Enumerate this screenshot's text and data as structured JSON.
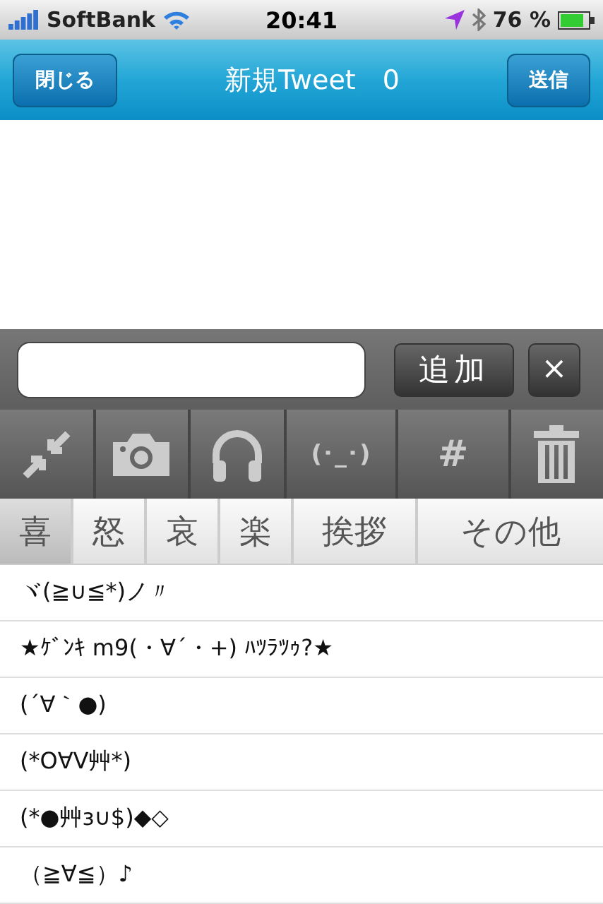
{
  "status_bar": {
    "carrier": "SoftBank",
    "time": "20:41",
    "battery": "76 %"
  },
  "nav": {
    "left_button": "閉じる",
    "title": "新規Tweet　0",
    "right_button": "送信"
  },
  "input_bar": {
    "add_button": "追加",
    "clear_button": "×"
  },
  "toolbar": [
    {
      "kind": "shrink"
    },
    {
      "kind": "camera"
    },
    {
      "kind": "headphones"
    },
    {
      "kind": "text",
      "label": "(･_･)"
    },
    {
      "kind": "text",
      "label": "#"
    },
    {
      "kind": "trash"
    }
  ],
  "tabs": [
    {
      "label": "喜",
      "selected": true
    },
    {
      "label": "怒",
      "selected": false
    },
    {
      "label": "哀",
      "selected": false
    },
    {
      "label": "楽",
      "selected": false
    },
    {
      "label": "挨拶",
      "selected": false
    },
    {
      "label": "その他",
      "selected": false
    }
  ],
  "items": [
    "ヾ(≧∪≦*)ノ〃",
    "★ｹﾞﾝｷ m9(・∀´・+) ﾊﾂﾗﾂｩ?★",
    "(´∀｀●)",
    "(*O∀V艸*)",
    "(*●艸ɜ∪$)◆◇",
    "（≧∀≦）♪"
  ]
}
